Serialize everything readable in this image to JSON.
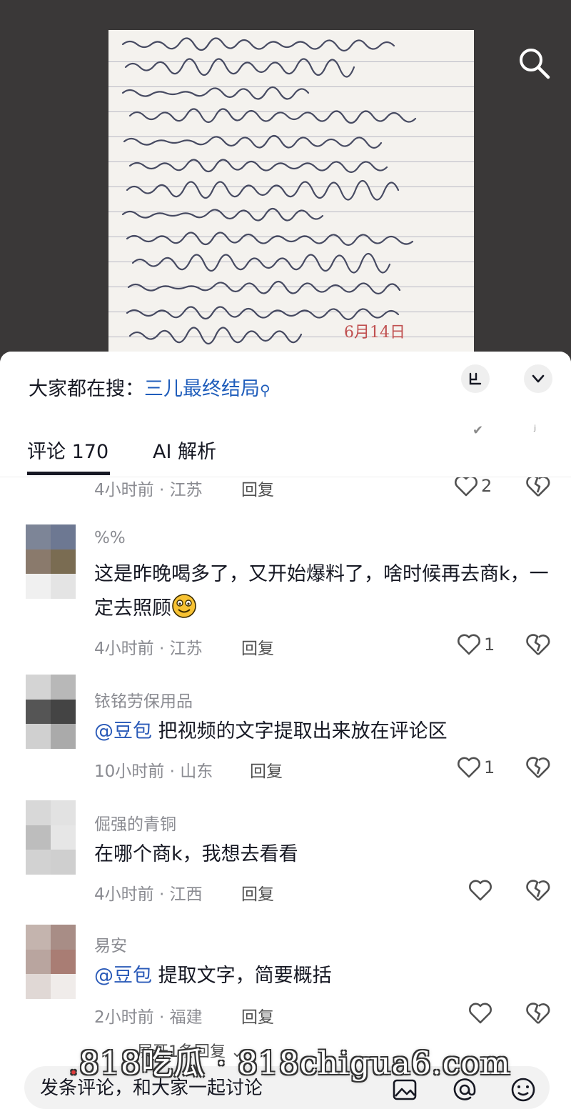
{
  "video": {
    "letter_date": "6月14日",
    "search_icon": "search-icon"
  },
  "hot_search": {
    "prefix": "大家都在搜：",
    "keyword": "三儿最终结局",
    "icon": "magnifier-icon"
  },
  "tabs": [
    {
      "label": "评论 170",
      "active": true
    },
    {
      "label": "AI 解析",
      "active": false
    }
  ],
  "comments": [
    {
      "username": "",
      "text": "",
      "time": "4小时前 · 江苏",
      "reply_label": "回复",
      "likes": "2"
    },
    {
      "username": "%%",
      "text": "这是昨晚喝多了，又开始爆料了，啥时候再去商k，一定去照顾",
      "emoji": "grinning-emoji",
      "time": "4小时前 · 江苏",
      "reply_label": "回复",
      "likes": "1"
    },
    {
      "username": "铱铭劳保用品",
      "mention": "@豆包",
      "text": " 把视频的文字提取出来放在评论区",
      "time": "10小时前 · 山东",
      "reply_label": "回复",
      "likes": "1"
    },
    {
      "username": "倔强的青铜",
      "text": "在哪个商k，我想去看看",
      "time": "4小时前 · 江西",
      "reply_label": "回复",
      "likes": ""
    },
    {
      "username": "易安",
      "mention": "@豆包",
      "text": " 提取文字，简要概括",
      "time": "2小时前 · 福建",
      "reply_label": "回复",
      "likes": ""
    }
  ],
  "expand_label": "展开1条回复",
  "input": {
    "placeholder": "发条评论，和大家一起讨论"
  },
  "watermark": "818吃瓜 · 818chigua6.com",
  "colors": {
    "accent_link": "#1f5dbb",
    "mention": "#2a5ab8",
    "meta_gray": "#8a8b91",
    "video_bg": "#3a3838"
  }
}
